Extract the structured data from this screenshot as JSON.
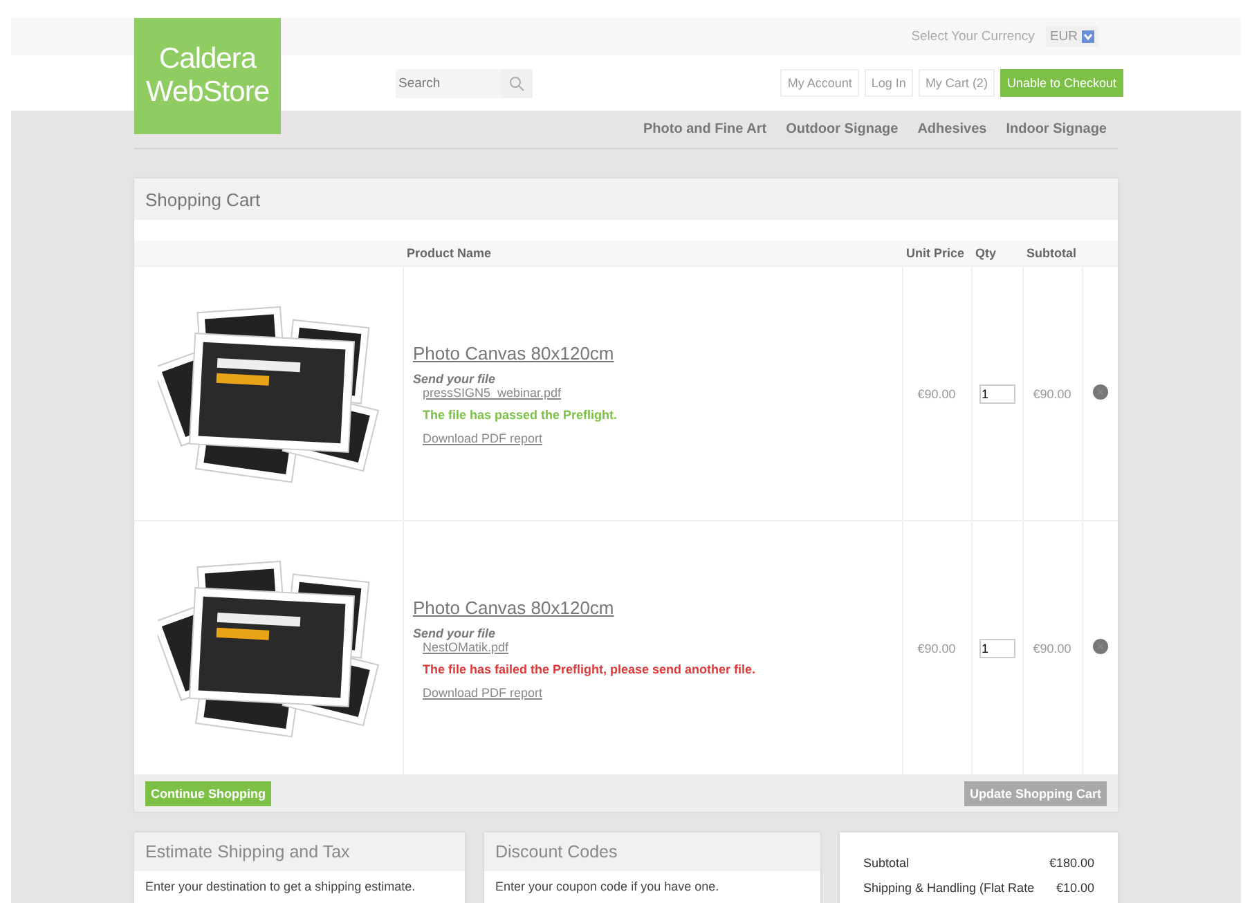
{
  "logo": {
    "lines": [
      "Caldera",
      "WebStore"
    ]
  },
  "currency": {
    "label": "Select Your Currency",
    "value": "EUR"
  },
  "search": {
    "placeholder": "Search"
  },
  "account_links": [
    {
      "label": "My Account",
      "kind": "plain"
    },
    {
      "label": "Log In",
      "kind": "plain"
    },
    {
      "label": "My Cart (2)",
      "kind": "plain"
    },
    {
      "label": "Unable to Checkout",
      "kind": "primary"
    }
  ],
  "nav": [
    "Photo and Fine Art",
    "Outdoor Signage",
    "Adhesives",
    "Indoor Signage"
  ],
  "cart": {
    "title": "Shopping Cart",
    "columns": [
      "Product Name",
      "Unit Price",
      "Qty",
      "Subtotal"
    ],
    "rows": [
      {
        "name": "Photo Canvas 80x120cm",
        "send_label": "Send your file",
        "file": "pressSIGN5_webinar.pdf",
        "passed": true,
        "message": "The file has passed the Preflight.",
        "report": "Download PDF report",
        "unit_price": "€90.00",
        "qty": "1",
        "subtotal": "€90.00"
      },
      {
        "name": "Photo Canvas 80x120cm",
        "send_label": "Send your file",
        "file": "NestOMatik.pdf",
        "passed": false,
        "message": "The file has failed the Preflight, please send another file.",
        "report": "Download PDF report",
        "unit_price": "€90.00",
        "qty": "1",
        "subtotal": "€90.00"
      }
    ],
    "continue_button": {
      "label": "Continue Shopping",
      "disabled": false
    },
    "update_button": {
      "label": "Update Shopping Cart",
      "disabled": true
    }
  },
  "shipping": {
    "title": "Estimate Shipping and Tax",
    "text": "Enter your destination to get a shipping estimate."
  },
  "discount": {
    "title": "Discount Codes",
    "text": "Enter your coupon code if you have one."
  },
  "totals": [
    {
      "label": "Subtotal",
      "value": "€180.00"
    },
    {
      "label": "Shipping & Handling (Flat Rate",
      "value": "€10.00"
    }
  ]
}
